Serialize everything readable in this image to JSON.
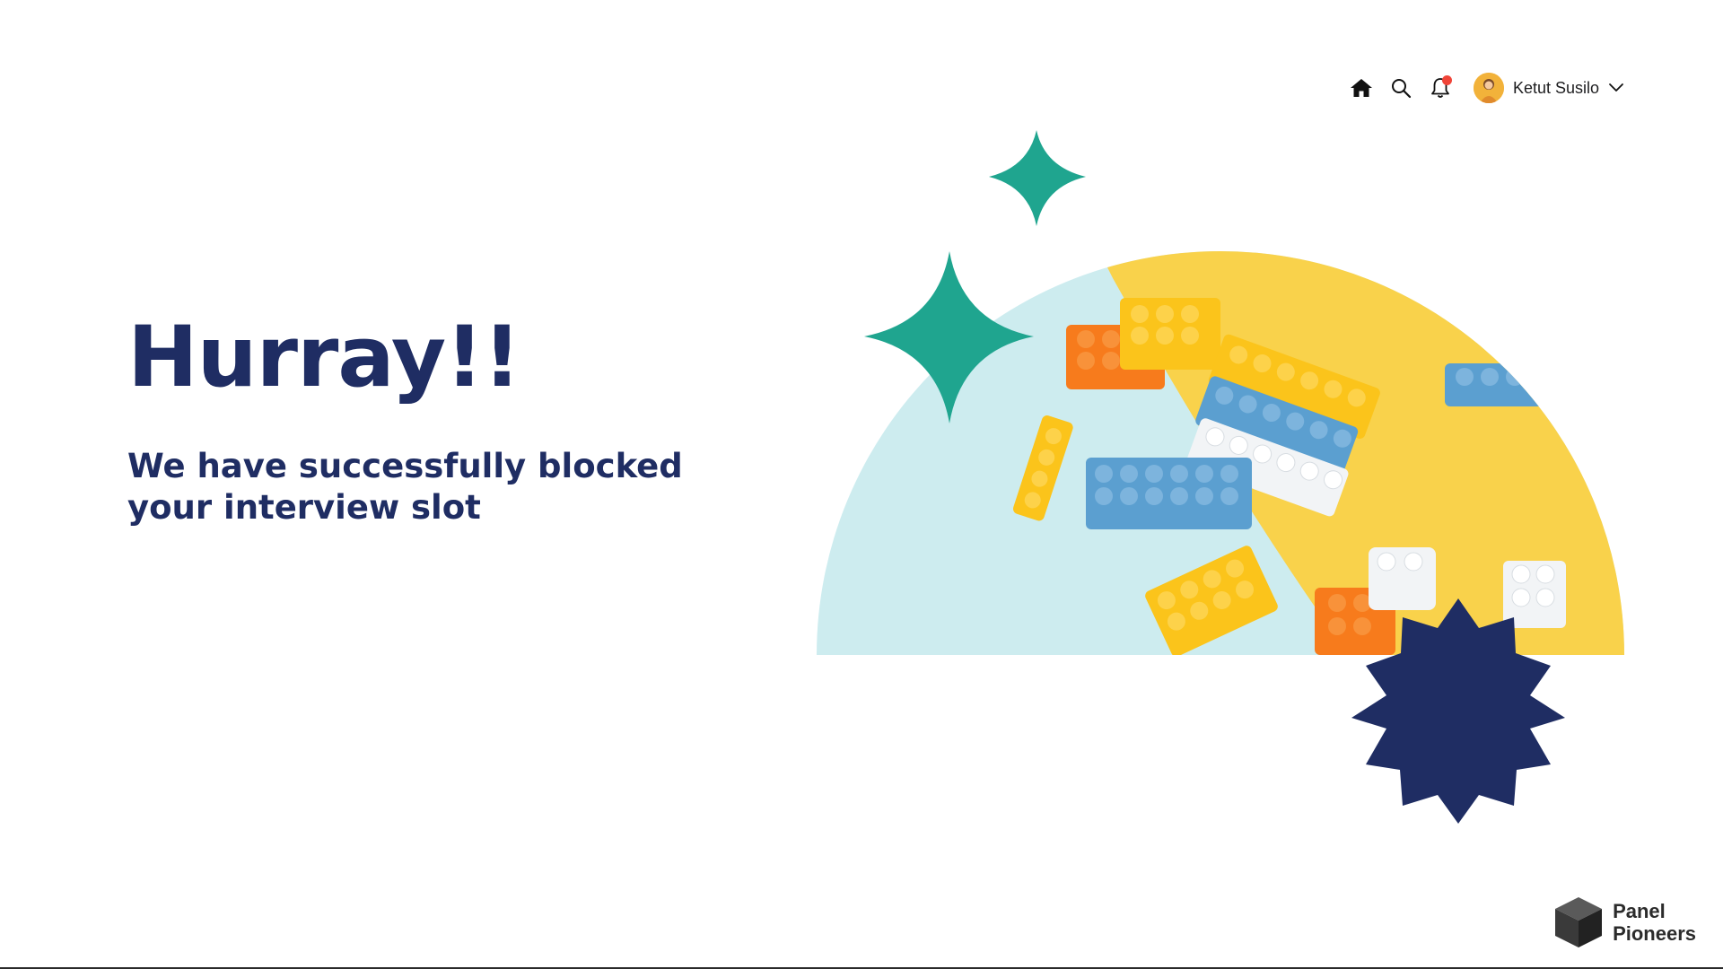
{
  "header": {
    "user_name": "Ketut Susilo",
    "icons": [
      "home-icon",
      "search-icon",
      "bell-icon",
      "chevron-down-icon"
    ],
    "has_notification": true
  },
  "hero": {
    "title": "Hurray!!",
    "subtitle": "We have successfully blocked your interview slot"
  },
  "brand": {
    "line1": "Panel",
    "line2": "Pioneers"
  },
  "colors": {
    "navy": "#1f2d63",
    "teal": "#1fa58f",
    "yellow": "#f9d24b",
    "light_blue": "#cdeef0",
    "notification": "#f04438"
  }
}
